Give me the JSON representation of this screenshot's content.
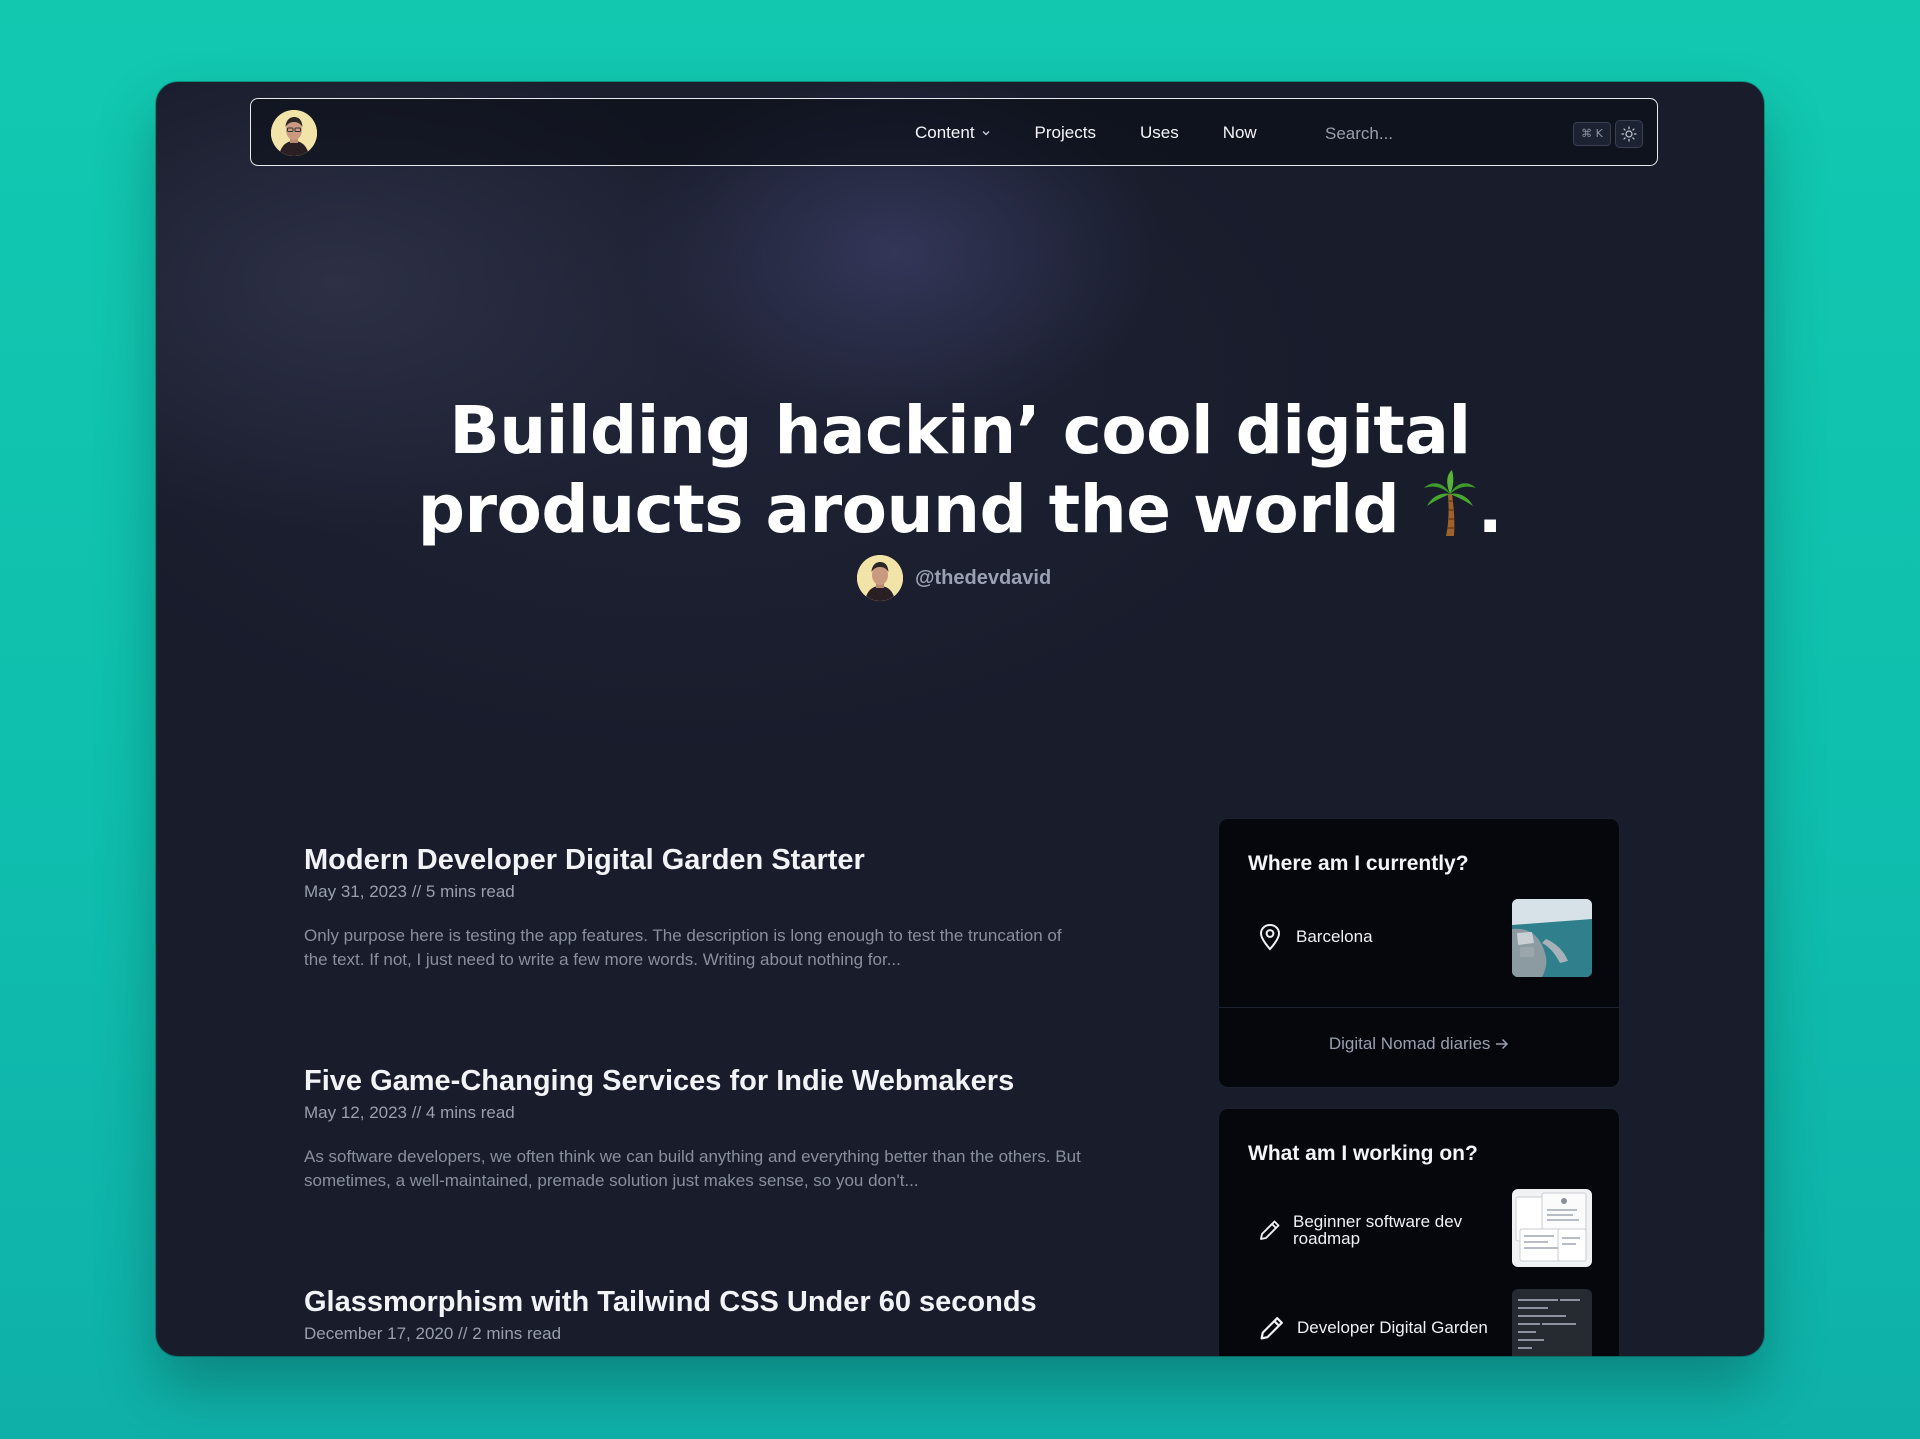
{
  "nav": {
    "links": [
      {
        "label": "Content",
        "has_dropdown": true
      },
      {
        "label": "Projects"
      },
      {
        "label": "Uses"
      },
      {
        "label": "Now"
      }
    ],
    "search_placeholder": "Search...",
    "shortcut": "⌘ K",
    "icons": {
      "logo": "avatar-icon",
      "theme": "sun-icon"
    }
  },
  "hero": {
    "title_line1": "Building hackin’ cool digital",
    "title_line2": "products around the world",
    "title_end": ".",
    "emoji": "palm-tree-icon",
    "handle": "@thedevdavid"
  },
  "posts": [
    {
      "title": "Modern Developer Digital Garden Starter",
      "meta": "May 31, 2023 // 5 mins read",
      "description": "Only purpose here is testing the app features. The description is long enough to test the truncation of the text. If not, I just need to write a few more words. Writing about nothing for..."
    },
    {
      "title": "Five Game-Changing Services for Indie Webmakers",
      "meta": "May 12, 2023 // 4 mins read",
      "description": "As software developers, we often think we can build anything and everything better than the others. But sometimes, a well-maintained, premade solution just makes sense, so you don't..."
    },
    {
      "title": "Glassmorphism with Tailwind CSS Under 60 seconds",
      "meta": "December 17, 2020 // 2 mins read",
      "description": ""
    }
  ],
  "location_card": {
    "title": "Where am I currently?",
    "location": "Barcelona",
    "link": "Digital Nomad diaries"
  },
  "work_card": {
    "title": "What am I working on?",
    "items": [
      {
        "label": "Beginner software dev roadmap"
      },
      {
        "label": "Developer Digital Garden"
      }
    ]
  },
  "colors": {
    "background": "#12c9b0",
    "window": "#181c2b",
    "card": "#05070d",
    "text": "#f2f3f7",
    "muted": "#9a9faf"
  }
}
